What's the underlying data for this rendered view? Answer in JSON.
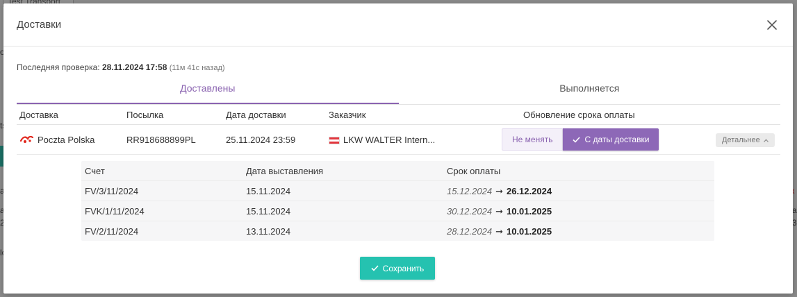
{
  "background": {
    "tab_label": "Test Transport",
    "fragments": [
      "ос",
      "a",
      "a",
      "2",
      "lo",
      "ts",
      "к",
      "a",
      "3"
    ]
  },
  "modal": {
    "title": "Доставки",
    "close_icon": "close-icon"
  },
  "last_check": {
    "label": "Последняя проверка:",
    "datetime": "28.11.2024 17:58",
    "ago": "(11м 41с назад)"
  },
  "tabs": [
    {
      "label": "Доставлены",
      "active": true
    },
    {
      "label": "Выполняется",
      "active": false
    }
  ],
  "table": {
    "headers": {
      "delivery": "Доставка",
      "parcel": "Посылка",
      "delivery_date": "Дата доставки",
      "customer": "Заказчик",
      "payment_update": "Обновление срока оплаты"
    },
    "row": {
      "carrier": "Poczta Polska",
      "parcel": "RR918688899PL",
      "delivery_date": "25.11.2024 23:59",
      "customer": "LKW WALTER Intern...",
      "option_keep": "Не менять",
      "option_from_delivery": "С даты доставки",
      "details": "Детальнее"
    }
  },
  "invoices": {
    "headers": {
      "invoice": "Счет",
      "issue_date": "Дата выставления",
      "due_date": "Срок оплаты"
    },
    "rows": [
      {
        "invoice": "FV/3/11/2024",
        "issue_date": "15.11.2024",
        "old_due": "15.12.2024",
        "new_due": "26.12.2024"
      },
      {
        "invoice": "FVK/1/11/2024",
        "issue_date": "15.11.2024",
        "old_due": "30.12.2024",
        "new_due": "10.01.2025"
      },
      {
        "invoice": "FV/2/11/2024",
        "issue_date": "13.11.2024",
        "old_due": "28.12.2024",
        "new_due": "10.01.2025"
      }
    ]
  },
  "save_button": "Сохранить",
  "colors": {
    "accent": "#8a63b0",
    "save": "#25c2b0",
    "carrier_brand": "#e1251b"
  }
}
